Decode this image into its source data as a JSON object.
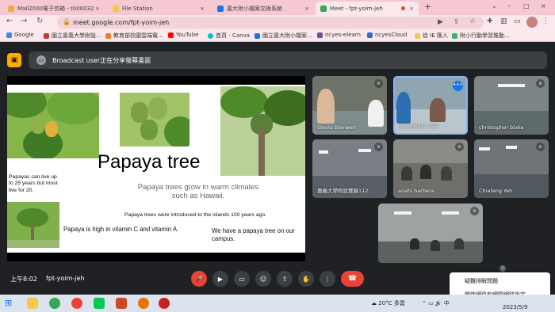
{
  "browser": {
    "tabs": [
      {
        "label": "Mail2000電子信箱 - t000032",
        "close": "×",
        "active": false,
        "favicon_color": "#f4a742"
      },
      {
        "label": "File Station",
        "close": "×",
        "active": false,
        "favicon_color": "#f2c94c"
      },
      {
        "label": "嘉大附小檔案交換系統",
        "close": "×",
        "active": false,
        "favicon_color": "#1a73e8"
      },
      {
        "label": "Meet - fpt-yoim-jeh",
        "close": "×",
        "active": true,
        "favicon_color": "#34a853"
      }
    ],
    "new_tab": "+",
    "window_controls": [
      "⌄",
      "–",
      "□",
      "×"
    ],
    "url": "meet.google.com/fpt-yoim-jeh",
    "bookmarks": [
      {
        "label": "Google",
        "icon_color": "#4285f4"
      },
      {
        "label": "國立嘉義大學附設...",
        "icon_color": "#c0392b"
      },
      {
        "label": "教育部校園雲端電...",
        "icon_color": "#e67e22"
      },
      {
        "label": "YouTube",
        "icon_color": "#ff0000"
      },
      {
        "label": "首頁 - Canva",
        "icon_color": "#00c4cc"
      },
      {
        "label": "國立嘉大附小檔案...",
        "icon_color": "#1a73e8"
      },
      {
        "label": "ncyes-elearn",
        "icon_color": "#7a4b94"
      },
      {
        "label": "ncyesCloud",
        "icon_color": "#2d6cdf"
      },
      {
        "label": "從 IE 匯入",
        "icon_color": "#f2c94c"
      },
      {
        "label": "附小行動學習推動...",
        "icon_color": "#3cb371"
      }
    ]
  },
  "meet": {
    "share_banner": "Broadcast user正在分享螢幕畫面",
    "slide": {
      "title": "Papaya tree",
      "subtitle": "Papaya trees grow in warm climates such as Hawaii.",
      "left_note": "Papayas can live up to 25 years  but most live for 20.",
      "intro_note": "Papaya trees were introduced to the islands 100 years ago.",
      "vitamin_note": "Papaya is high in vitamin C and vitamin A.",
      "campus_note": "We have a papaya tree on our campus."
    },
    "participants": [
      {
        "name": "Sheila Bierwert"
      },
      {
        "name": "Broadcast user",
        "more": "•••"
      },
      {
        "name": "christopher blake"
      },
      {
        "name": "嘉義大學附設實驗112..."
      },
      {
        "name": "anahi barbera"
      },
      {
        "name": "Chiafeng Yeh"
      },
      {
        "name": ""
      }
    ],
    "time": "上午8:02",
    "meeting_code": "fpt-yoim-jeh",
    "menu": {
      "items": [
        "疑難排解問題",
        "開啟網路和網際網路設定"
      ]
    }
  },
  "taskbar": {
    "weather": "20°C 多雲",
    "date": "2023/5/9"
  }
}
